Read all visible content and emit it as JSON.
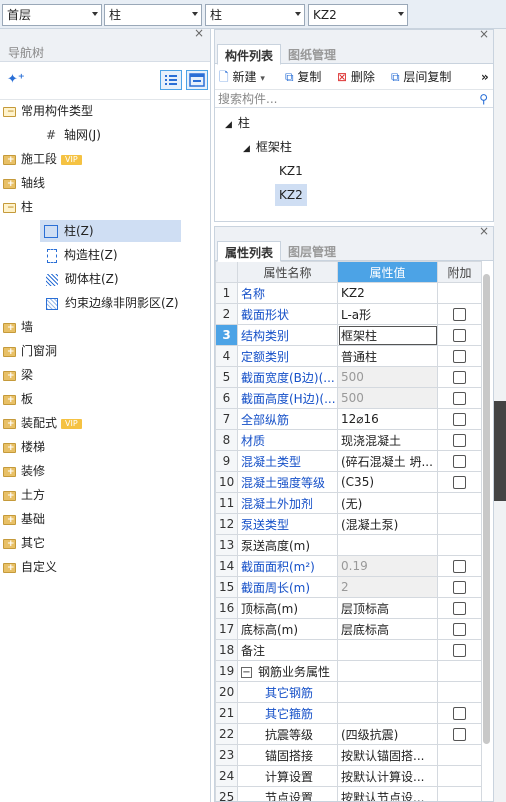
{
  "topbar": {
    "floor": "首层",
    "category": "柱",
    "subcategory": "柱",
    "component": "KZ2"
  },
  "nav": {
    "title": "导航树",
    "close": "×",
    "items": [
      {
        "label": "常用构件类型",
        "kind": "folder-open"
      },
      {
        "label": "轴网(J)",
        "kind": "child"
      },
      {
        "label": "施工段",
        "kind": "folder",
        "badge": "VIP"
      },
      {
        "label": "轴线",
        "kind": "folder"
      },
      {
        "label": "柱",
        "kind": "folder-open"
      },
      {
        "label": "柱(Z)",
        "kind": "child-selected"
      },
      {
        "label": "构造柱(Z)",
        "kind": "child"
      },
      {
        "label": "砌体柱(Z)",
        "kind": "child"
      },
      {
        "label": "约束边缘非阴影区(Z)",
        "kind": "child"
      },
      {
        "label": "墙",
        "kind": "folder"
      },
      {
        "label": "门窗洞",
        "kind": "folder"
      },
      {
        "label": "梁",
        "kind": "folder"
      },
      {
        "label": "板",
        "kind": "folder"
      },
      {
        "label": "装配式",
        "kind": "folder",
        "badge": "VIP"
      },
      {
        "label": "楼梯",
        "kind": "folder"
      },
      {
        "label": "装修",
        "kind": "folder"
      },
      {
        "label": "土方",
        "kind": "folder"
      },
      {
        "label": "基础",
        "kind": "folder"
      },
      {
        "label": "其它",
        "kind": "folder"
      },
      {
        "label": "自定义",
        "kind": "folder"
      }
    ]
  },
  "components": {
    "tabs": [
      "构件列表",
      "图纸管理"
    ],
    "toolbar": {
      "new": "新建",
      "copy": "复制",
      "delete": "删除",
      "floor_copy": "层间复制",
      "more": "»"
    },
    "search_placeholder": "搜索构件...",
    "tree": {
      "root": "柱",
      "group": "框架柱",
      "items": [
        "KZ1",
        "KZ2"
      ],
      "selected": "KZ2"
    }
  },
  "properties": {
    "tabs": [
      "属性列表",
      "图层管理"
    ],
    "headers": {
      "name": "属性名称",
      "value": "属性值",
      "extra": "附加"
    },
    "rows": [
      {
        "n": "1",
        "name": "名称",
        "value": "KZ2",
        "style": "blue",
        "cb": false
      },
      {
        "n": "2",
        "name": "截面形状",
        "value": "L-a形",
        "style": "blue",
        "cb": true
      },
      {
        "n": "3",
        "name": "结构类别",
        "value": "框架柱",
        "style": "blue",
        "cb": true,
        "selected": true
      },
      {
        "n": "4",
        "name": "定额类别",
        "value": "普通柱",
        "style": "blue",
        "cb": true
      },
      {
        "n": "5",
        "name": "截面宽度(B边)(...",
        "value": "500",
        "style": "blue",
        "cb": true,
        "gray": true
      },
      {
        "n": "6",
        "name": "截面高度(H边)(...",
        "value": "500",
        "style": "blue",
        "cb": true,
        "gray": true
      },
      {
        "n": "7",
        "name": "全部纵筋",
        "value": "12⌀16",
        "style": "blue",
        "cb": true
      },
      {
        "n": "8",
        "name": "材质",
        "value": "现浇混凝土",
        "style": "blue",
        "cb": true
      },
      {
        "n": "9",
        "name": "混凝土类型",
        "value": "(碎石混凝土 坍...",
        "style": "blue",
        "cb": true
      },
      {
        "n": "10",
        "name": "混凝土强度等级",
        "value": "(C35)",
        "style": "blue",
        "cb": true
      },
      {
        "n": "11",
        "name": "混凝土外加剂",
        "value": "(无)",
        "style": "blue",
        "cb": false
      },
      {
        "n": "12",
        "name": "泵送类型",
        "value": "(混凝土泵)",
        "style": "blue",
        "cb": false
      },
      {
        "n": "13",
        "name": "泵送高度(m)",
        "value": "",
        "style": "",
        "cb": false
      },
      {
        "n": "14",
        "name": "截面面积(m²)",
        "value": "0.19",
        "style": "blue",
        "cb": true,
        "gray": true
      },
      {
        "n": "15",
        "name": "截面周长(m)",
        "value": "2",
        "style": "blue",
        "cb": true,
        "gray": true
      },
      {
        "n": "16",
        "name": "顶标高(m)",
        "value": "层顶标高",
        "style": "",
        "cb": true
      },
      {
        "n": "17",
        "name": "底标高(m)",
        "value": "层底标高",
        "style": "",
        "cb": true
      },
      {
        "n": "18",
        "name": "备注",
        "value": "",
        "style": "",
        "cb": true
      },
      {
        "n": "19",
        "name": "钢筋业务属性",
        "value": "",
        "style": "group",
        "cb": false
      },
      {
        "n": "20",
        "name": "其它钢筋",
        "value": "",
        "style": "blue-indent",
        "cb": false
      },
      {
        "n": "21",
        "name": "其它箍筋",
        "value": "",
        "style": "blue-indent",
        "cb": true
      },
      {
        "n": "22",
        "name": "抗震等级",
        "value": "(四级抗震)",
        "style": "indent",
        "cb": true
      },
      {
        "n": "23",
        "name": "锚固搭接",
        "value": "按默认锚固搭...",
        "style": "indent",
        "cb": false
      },
      {
        "n": "24",
        "name": "计算设置",
        "value": "按默认计算设...",
        "style": "indent",
        "cb": false
      },
      {
        "n": "25",
        "name": "节点设置",
        "value": "按默认节点设...",
        "style": "indent",
        "cb": false
      }
    ]
  },
  "colors": {
    "accent": "#4ca3e6",
    "blue_text": "#1550c8",
    "selection": "#cfdef3"
  }
}
